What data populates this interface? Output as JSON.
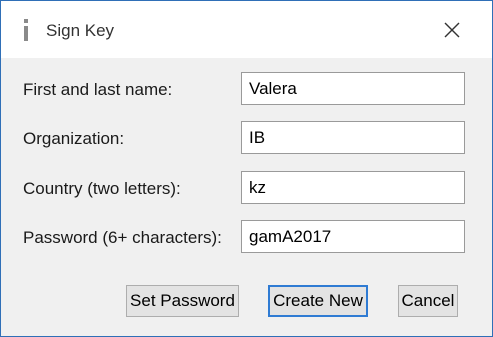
{
  "dialog": {
    "title": "Sign Key",
    "icon": "info-icon"
  },
  "fields": [
    {
      "label": "First and last name:",
      "value": "Valera"
    },
    {
      "label": "Organization:",
      "value": "IB"
    },
    {
      "label": "Country (two letters):",
      "value": "kz"
    },
    {
      "label": "Password (6+ characters):",
      "value": "gamA2017"
    }
  ],
  "buttons": {
    "set_password": "Set Password",
    "create_new": "Create New",
    "cancel": "Cancel"
  },
  "colors": {
    "window_border": "#2f6fb7",
    "default_button_border": "#2f7bd3",
    "content_background": "#f0f0f0"
  }
}
